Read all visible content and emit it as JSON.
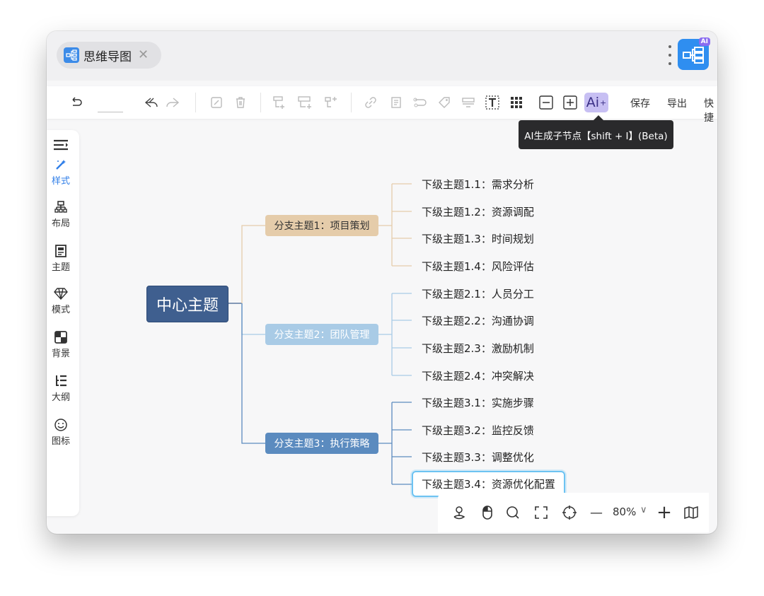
{
  "window": {
    "tab_label": "思维导图",
    "tab_close": "✕",
    "logo_badge": "AI"
  },
  "toolbar": {
    "ai_label": "Ai",
    "ai_sup": "+",
    "save_label": "保存",
    "export_label": "导出",
    "shortcut_label": "快捷",
    "tooltip": "AI生成子节点【shift + I】(Beta)"
  },
  "sidebar": {
    "items": [
      {
        "label": "样式",
        "icon": "magic-wand-icon"
      },
      {
        "label": "布局",
        "icon": "layout-icon"
      },
      {
        "label": "主题",
        "icon": "theme-icon"
      },
      {
        "label": "模式",
        "icon": "diamond-icon"
      },
      {
        "label": "背景",
        "icon": "background-icon"
      },
      {
        "label": "大纲",
        "icon": "outline-icon"
      },
      {
        "label": "图标",
        "icon": "emoji-icon"
      }
    ]
  },
  "mindmap": {
    "root": "中心主题",
    "branches": [
      {
        "label": "分支主题1：项目策划",
        "children": [
          "下级主题1.1：需求分析",
          "下级主题1.2：资源调配",
          "下级主题1.3：时间规划",
          "下级主题1.4：风险评估"
        ]
      },
      {
        "label": "分支主题2：团队管理",
        "children": [
          "下级主题2.1：人员分工",
          "下级主题2.2：沟通协调",
          "下级主题2.3：激励机制",
          "下级主题2.4：冲突解决"
        ]
      },
      {
        "label": "分支主题3：执行策略",
        "children": [
          "下级主题3.1：实施步骤",
          "下级主题3.2：监控反馈",
          "下级主题3.3：调整优化",
          "下级主题3.4：资源优化配置"
        ]
      }
    ],
    "colors": {
      "branch1": "#e5ccaa",
      "branch2": "#a9cbe6",
      "branch3": "#5b8bbf",
      "root": "#3f5f8f",
      "selected": "#6dc3f2"
    }
  },
  "bottombar": {
    "zoom": "80%",
    "zoom_minus": "—",
    "zoom_plus": "+",
    "zoom_caret": "∨"
  }
}
